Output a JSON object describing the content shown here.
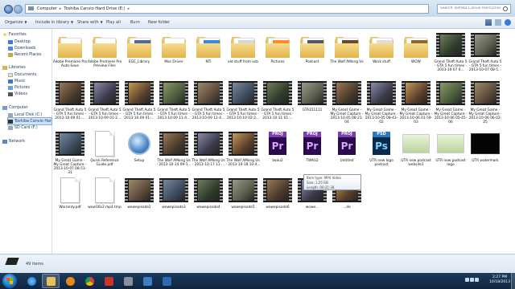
{
  "window": {
    "breadcrumb": [
      "Computer",
      "Toshiba Canvio Hard Drive (E:)"
    ],
    "search_placeholder": "Search Toshiba Canvio Hard Drive (E:)"
  },
  "toolbar": {
    "organize": "Organize",
    "include_in_library": "Include in library",
    "share_with": "Share with",
    "play_all": "Play all",
    "burn": "Burn",
    "new_folder": "New folder"
  },
  "nav": {
    "favorites": "Favorites",
    "desktop": "Desktop",
    "downloads": "Downloads",
    "recent_places": "Recent Places",
    "libraries": "Libraries",
    "documents": "Documents",
    "music": "Music",
    "pictures": "Pictures",
    "videos": "Videos",
    "computer": "Computer",
    "local_disk": "Local Disk (C:)",
    "toshiba": "Toshiba Canvio Har",
    "sd_card": "SD Card (F:)",
    "network": "Network"
  },
  "files": [
    {
      "name": "Adobe Premiere Pro Auto-Save",
      "type": "folder"
    },
    {
      "name": "Adobe Premiere Pro Preview Files",
      "type": "folder"
    },
    {
      "name": "EGC_Library",
      "type": "folder"
    },
    {
      "name": "Mac Driver",
      "type": "folder"
    },
    {
      "name": "NTI",
      "type": "folder"
    },
    {
      "name": "old stuff from usb",
      "type": "folder"
    },
    {
      "name": "Pictures",
      "type": "folder"
    },
    {
      "name": "Podcast",
      "type": "folder"
    },
    {
      "name": "The Wolf AMong Us",
      "type": "folder"
    },
    {
      "name": "Work stuff",
      "type": "folder"
    },
    {
      "name": "WOW",
      "type": "folder"
    },
    {
      "name": "Grand Theft Auto 5 - GTA 5 fun times - 2013-10-07 6...",
      "type": "video"
    },
    {
      "name": "Grand Theft Auto 5 - GTA 5 fun times - 2013-10-07 08-5...",
      "type": "video"
    },
    {
      "name": "Grand Theft Auto 5 - GTA 5 fun times - 2013-10-09 01-...",
      "type": "video"
    },
    {
      "name": "Grand Theft Auto 5 - GTA 5 fun times - 2013-10-09 01-2...",
      "type": "video"
    },
    {
      "name": "Grand Theft Auto 5 - GTA 5 fun times - 2013-10-09 01-...",
      "type": "video"
    },
    {
      "name": "Grand Theft Auto 5 - GTA 5 fun times - 2013-10-09 11-4...",
      "type": "video"
    },
    {
      "name": "Grand Theft Auto 5 - GTA 5 fun times - 2013-10-09 11-4...",
      "type": "video"
    },
    {
      "name": "Grand Theft Auto 5 - GTA 5 fun times - 2013-10-10 02-2...",
      "type": "video"
    },
    {
      "name": "Grand Theft Auto 5 - GTA 5 fun times - 2013-10-11 01-...",
      "type": "video"
    },
    {
      "name": "GTA151111",
      "type": "video"
    },
    {
      "name": "My Great Game - My Great Capture - 2013-10-05 08-21-04",
      "type": "video"
    },
    {
      "name": "My Great Game - My Great Capture - 2013-10-05 08-43-02",
      "type": "video"
    },
    {
      "name": "My Great Game - My Great Capture - 2013-10-06 01-59-03",
      "type": "video"
    },
    {
      "name": "My Great Game - My Great Capture - 2013-10-06 05-45-06",
      "type": "video"
    },
    {
      "name": "My Great Game - My Great Capture - 2013-10-06 06-02-25",
      "type": "video"
    },
    {
      "name": "My Great Game - My Great Capture - 2013-10-07 08-51-31",
      "type": "video"
    },
    {
      "name": "Quick Reference Guide.pdf",
      "type": "pdf"
    },
    {
      "name": "Setup",
      "type": "setup"
    },
    {
      "name": "The Wolf AMong Us - 2013-10-14 09-1...",
      "type": "video"
    },
    {
      "name": "The Wolf AMong Us - 2013-10-17 11-...",
      "type": "video"
    },
    {
      "name": "The Wolf AMong Us - 2013-10-18 10-4...",
      "type": "video"
    },
    {
      "name": "twau2",
      "type": "prproj"
    },
    {
      "name": "TWAU2",
      "type": "prproj"
    },
    {
      "name": "Untitled",
      "type": "prproj"
    },
    {
      "name": "UTR new logo podcast",
      "type": "psd"
    },
    {
      "name": "UTR new podcast website1",
      "type": "image"
    },
    {
      "name": "UTR new podcast logo",
      "type": "image"
    },
    {
      "name": "UTR watermark",
      "type": "image"
    },
    {
      "name": "Warranty.pdf",
      "type": "pdf"
    },
    {
      "name": "wow16x2.mp4.tmp",
      "type": "doc"
    },
    {
      "name": "wowepisode2",
      "type": "video"
    },
    {
      "name": "wowepisode3",
      "type": "video"
    },
    {
      "name": "wowepisode4",
      "type": "video"
    },
    {
      "name": "wowepisode5",
      "type": "video"
    },
    {
      "name": "wowepisode6",
      "type": "video"
    },
    {
      "name": "wowe...",
      "type": "video"
    },
    {
      "name": "...de",
      "type": "video"
    }
  ],
  "tooltip": {
    "line1": "Item type: MP4 Video",
    "line2": "Size: 1.25 GB",
    "line3": "Length: 00:21:38"
  },
  "status": {
    "item_count": "49 items"
  },
  "clock": {
    "time": "2:27 PM",
    "date": "10/18/2013"
  },
  "colors": {
    "premiere": "#2a0a4a",
    "premiere_text": "#d9a6ff",
    "photoshop": "#0a2a4a",
    "photoshop_text": "#7fd1ff"
  }
}
